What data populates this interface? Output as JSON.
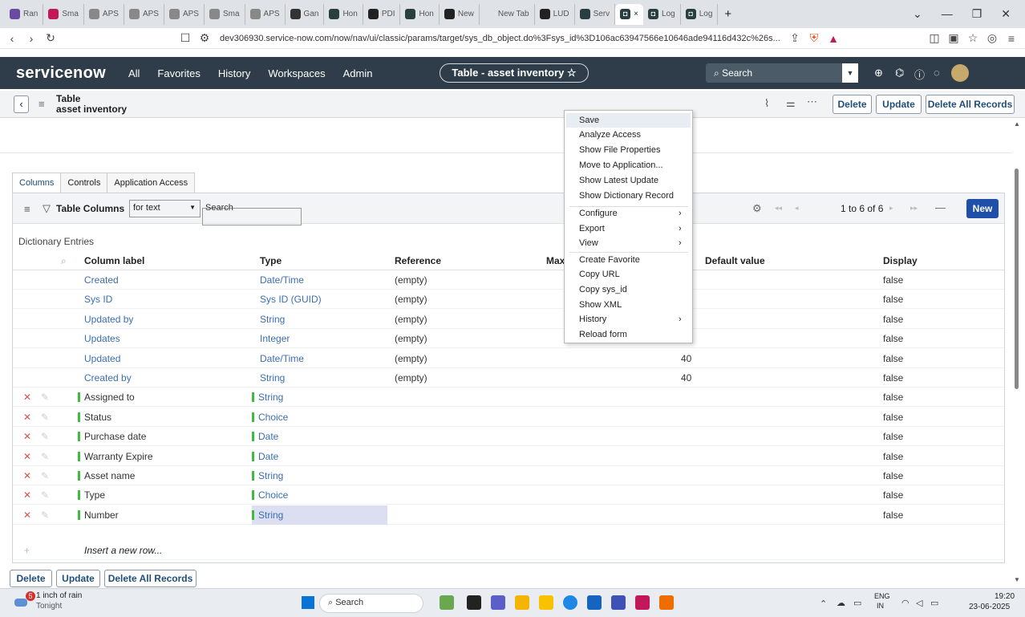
{
  "browser": {
    "tabs": [
      {
        "label": "Ran",
        "color": "#6b4aa1"
      },
      {
        "label": "Sma",
        "color": "#c2185b"
      },
      {
        "label": "APS",
        "color": "#888"
      },
      {
        "label": "APS",
        "color": "#888"
      },
      {
        "label": "APS",
        "color": "#888"
      },
      {
        "label": "Sma",
        "color": "#888"
      },
      {
        "label": "APS",
        "color": "#888"
      },
      {
        "label": "Gan",
        "color": "#333"
      },
      {
        "label": "Hon",
        "color": "#293e40"
      },
      {
        "label": "PDI",
        "color": "#222"
      },
      {
        "label": "Hon",
        "color": "#293e40"
      },
      {
        "label": "New",
        "color": "#222"
      },
      {
        "label": "New Tab",
        "color": ""
      },
      {
        "label": "LUD",
        "color": "#222"
      },
      {
        "label": "Serv",
        "color": "#293e40"
      }
    ],
    "active_tab": "×",
    "extra_tabs": [
      "Log",
      "Log"
    ],
    "url": "dev306930.service-now.com/now/nav/ui/classic/params/target/sys_db_object.do%3Fsys_id%3D106ac63947566e10646ade94116d432c%26s..."
  },
  "header": {
    "logo": "servicenow",
    "menus": [
      "All",
      "Favorites",
      "History",
      "Workspaces",
      "Admin"
    ],
    "table_pill": "Table - asset inventory ☆",
    "search_placeholder": "Search"
  },
  "form": {
    "title": "Table",
    "subtitle": "asset inventory",
    "buttons": {
      "delete": "Delete",
      "update": "Update",
      "delete_all": "Delete All Records"
    }
  },
  "tabs": [
    "Columns",
    "Controls",
    "Application Access"
  ],
  "list": {
    "title": "Table Columns",
    "filter_value": "for text",
    "search_placeholder": "Search",
    "pagination": "1  to 6 of 6",
    "new_label": "New",
    "section_label": "Dictionary Entries",
    "columns": [
      "Column label",
      "Type",
      "Reference",
      "Max",
      "Default value",
      "Display"
    ],
    "rows": [
      {
        "label": "Created",
        "type": "Date/Time",
        "ref": "(empty)",
        "max": "",
        "display": "false",
        "sys": true
      },
      {
        "label": "Sys ID",
        "type": "Sys ID (GUID)",
        "ref": "(empty)",
        "max": "",
        "display": "false",
        "sys": true
      },
      {
        "label": "Updated by",
        "type": "String",
        "ref": "(empty)",
        "max": "",
        "display": "false",
        "sys": true
      },
      {
        "label": "Updates",
        "type": "Integer",
        "ref": "(empty)",
        "max": "",
        "display": "false",
        "sys": true
      },
      {
        "label": "Updated",
        "type": "Date/Time",
        "ref": "(empty)",
        "max": "40",
        "display": "false",
        "sys": true
      },
      {
        "label": "Created by",
        "type": "String",
        "ref": "(empty)",
        "max": "40",
        "display": "false",
        "sys": true
      },
      {
        "label": "Assigned to",
        "type": "String",
        "ref": "",
        "max": "",
        "display": "false",
        "sys": false
      },
      {
        "label": "Status",
        "type": "Choice",
        "ref": "",
        "max": "",
        "display": "false",
        "sys": false
      },
      {
        "label": "Purchase date",
        "type": "Date",
        "ref": "",
        "max": "",
        "display": "false",
        "sys": false
      },
      {
        "label": "Warranty Expire",
        "type": "Date",
        "ref": "",
        "max": "",
        "display": "false",
        "sys": false
      },
      {
        "label": "Asset name",
        "type": "String",
        "ref": "",
        "max": "",
        "display": "false",
        "sys": false
      },
      {
        "label": "Type",
        "type": "Choice",
        "ref": "",
        "max": "",
        "display": "false",
        "sys": false
      },
      {
        "label": "Number",
        "type": "String",
        "ref": "",
        "max": "",
        "display": "false",
        "sys": false
      }
    ],
    "insert_row": "Insert a new row..."
  },
  "context_menu": {
    "items": [
      "Save",
      "Analyze Access",
      "Show File Properties",
      "Move to Application...",
      "Show Latest Update",
      "Show Dictionary Record",
      "Configure",
      "Export",
      "View",
      "Create Favorite",
      "Copy URL",
      "Copy sys_id",
      "Show XML",
      "History",
      "Reload form"
    ]
  },
  "taskbar": {
    "weather": "1 inch of rain",
    "weather_sub": "Tonight",
    "weather_badge": "5",
    "search": "Search",
    "lang": "ENG",
    "region": "IN",
    "time": "19:20",
    "date": "23-06-2025"
  }
}
